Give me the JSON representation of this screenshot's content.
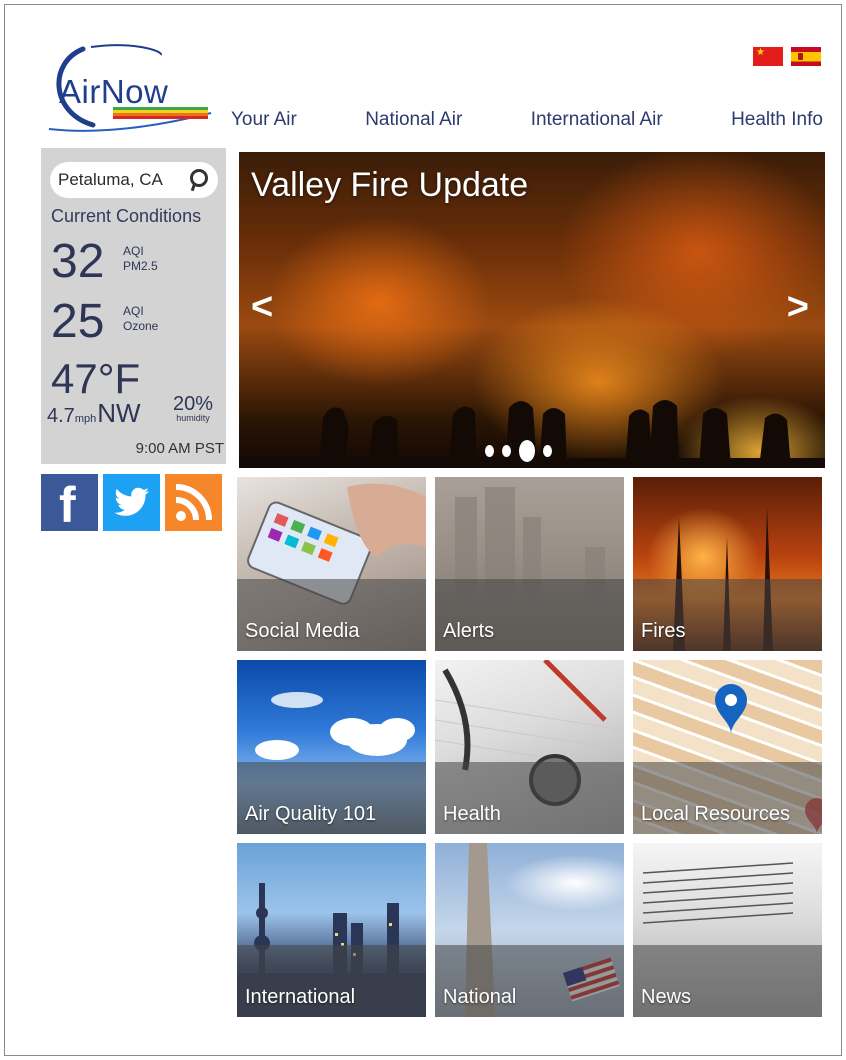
{
  "brand": {
    "logo_text": "AirNow"
  },
  "languages": [
    {
      "name": "chinese-flag"
    },
    {
      "name": "spanish-flag"
    }
  ],
  "nav": {
    "items": [
      "Your Air",
      "National Air",
      "International Air",
      "Health Info"
    ]
  },
  "conditions": {
    "location": "Petaluma, CA",
    "title": "Current Conditions",
    "pm25": {
      "value": "32",
      "label1": "AQI",
      "label2": "PM2.5"
    },
    "ozone": {
      "value": "25",
      "label1": "AQI",
      "label2": "Ozone"
    },
    "temperature": "47°F",
    "wind_speed": "4.7",
    "wind_unit": "mph",
    "wind_dir": "NW",
    "humidity_value": "20%",
    "humidity_label": "humidity",
    "time": "9:00 AM PST"
  },
  "social": [
    "facebook-icon",
    "twitter-icon",
    "rss-icon"
  ],
  "hero": {
    "title": "Valley Fire Update",
    "prev": "<",
    "next": ">",
    "slide_count": 4,
    "active_slide": 3
  },
  "tiles": [
    {
      "label": "Social Media"
    },
    {
      "label": "Alerts"
    },
    {
      "label": "Fires"
    },
    {
      "label": "Air Quality 101"
    },
    {
      "label": "Health"
    },
    {
      "label": "Local Resources"
    },
    {
      "label": "International"
    },
    {
      "label": "National"
    },
    {
      "label": "News"
    }
  ],
  "colors": {
    "brand_blue": "#1f3f8c",
    "panel_gray": "#d3d3d3",
    "nav_text": "#2d3a6e",
    "facebook": "#3b5998",
    "twitter": "#1da1f2",
    "rss": "#f5862a"
  }
}
